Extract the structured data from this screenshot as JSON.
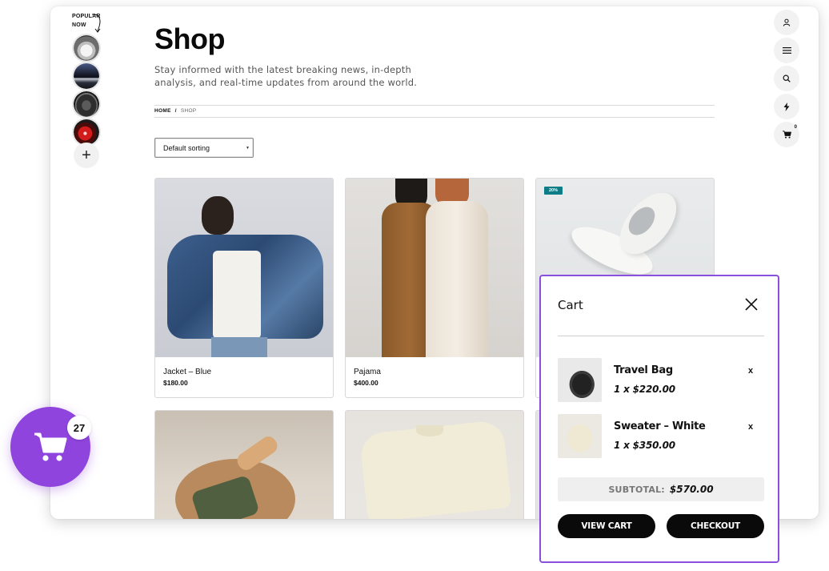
{
  "stories": {
    "label_line1": "POPULAR",
    "label_line2": "NOW",
    "items": [
      {
        "name": "story-car-white"
      },
      {
        "name": "story-car-limo"
      },
      {
        "name": "story-car-dark"
      },
      {
        "name": "story-car-dashboard"
      }
    ],
    "add_symbol": "+"
  },
  "header": {
    "title": "Shop",
    "subtitle": "Stay informed with the latest breaking news, in-depth analysis, and real-time updates from around the world."
  },
  "breadcrumb": {
    "home": "HOME",
    "separator": "/",
    "current": "SHOP"
  },
  "sorting": {
    "selected": "Default sorting"
  },
  "products": [
    {
      "name": "Jacket – Blue",
      "price": "$180.00"
    },
    {
      "name": "Pajama",
      "price": "$400.00"
    },
    {
      "name": "",
      "price": "",
      "badge": "20%"
    }
  ],
  "right_icons": {
    "cart_count": "0",
    "icons": [
      "user-icon",
      "menu-icon",
      "search-icon",
      "bolt-icon",
      "cart-icon"
    ]
  },
  "cart": {
    "title": "Cart",
    "items": [
      {
        "name": "Travel Bag",
        "qty": "1 x $220.00",
        "remove": "x"
      },
      {
        "name": "Sweater – White",
        "qty": "1 x $350.00",
        "remove": "x"
      }
    ],
    "subtotal_label": "SUBTOTAL:",
    "subtotal_value": "$570.00",
    "view_cart": "VIEW CART",
    "checkout": "CHECKOUT"
  },
  "floating_cart": {
    "count": "27"
  },
  "colors": {
    "accent": "#8f44dd",
    "badge": "#0c7d86"
  }
}
